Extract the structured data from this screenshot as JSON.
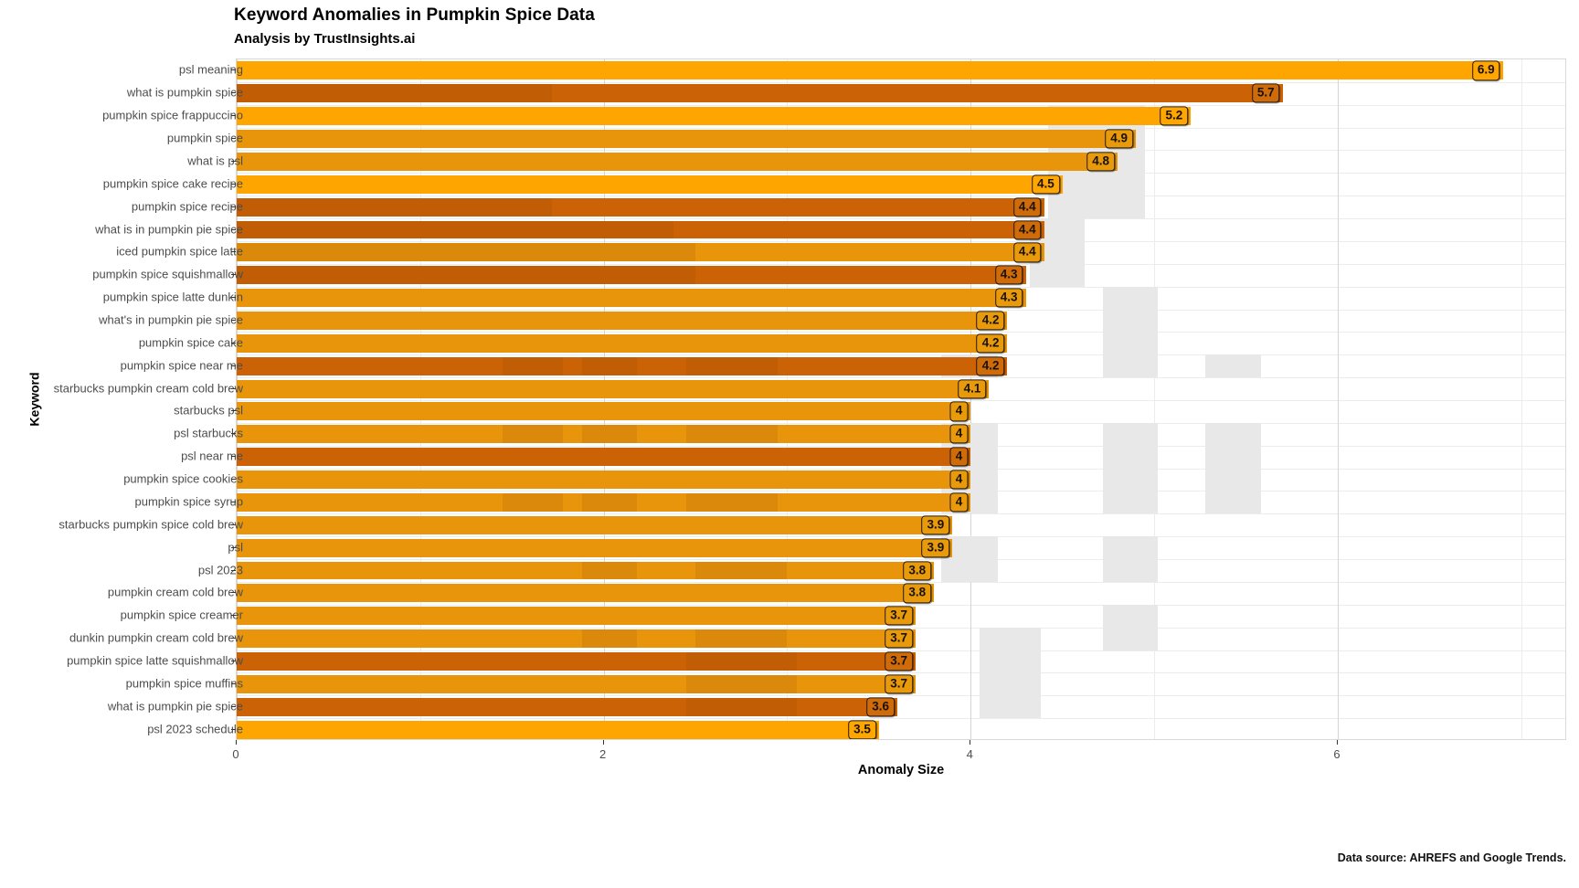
{
  "header": {
    "title": "Keyword Anomalies in Pumpkin Spice Data",
    "subtitle": "Analysis by TrustInsights.ai"
  },
  "footer": {
    "caption": "Data source: AHREFS and Google Trends."
  },
  "colors": {
    "bar_light": "#FFA500",
    "bar_medium": "#E8950C",
    "bar_dark": "#CC6206",
    "label_light_fill": "#FFA600",
    "label_medium_fill": "#E89A0B",
    "label_dark_fill": "#CF6B08",
    "label_border": "#231a10",
    "gray_block": "#e8e8e8",
    "panel_bg": "#FFFFFF",
    "gridline": "#ececec"
  },
  "chart_data": {
    "type": "bar",
    "orientation": "horizontal",
    "title": "Keyword Anomalies in Pumpkin Spice Data",
    "subtitle": "Analysis by TrustInsights.ai",
    "xlabel": "Anomaly Size",
    "ylabel": "Keyword",
    "xlim": [
      0,
      7.25
    ],
    "xticks": [
      0,
      2,
      4,
      6
    ],
    "xtick_labels": [
      "0",
      "2",
      "4",
      "6"
    ],
    "grid": true,
    "legend": false,
    "categories": [
      "psl meaning",
      "what is pumpkin spice",
      "pumpkin spice frappuccino",
      "pumpkin spice",
      "what is psl",
      "pumpkin spice cake recipe",
      "pumpkin spice recipe",
      "what is in pumpkin pie spice",
      "iced pumpkin spice latte",
      "pumpkin spice squishmallow",
      "pumpkin spice latte dunkin",
      "what's in pumpkin pie spice",
      "pumpkin spice cake",
      "pumpkin spice near me",
      "starbucks pumpkin cream cold brew",
      "starbucks psl",
      "psl starbucks",
      "psl near me",
      "pumpkin spice cookies",
      "pumpkin spice syrup",
      "starbucks pumpkin spice cold brew",
      "psl",
      "psl 2023",
      "pumpkin cream cold brew",
      "pumpkin spice creamer",
      "dunkin pumpkin cream cold brew",
      "pumpkin spice latte squishmallow",
      "pumpkin spice muffins",
      "what is pumpkin pie spice",
      "psl 2023 schedule"
    ],
    "values": [
      6.9,
      5.7,
      5.2,
      4.9,
      4.8,
      4.5,
      4.4,
      4.4,
      4.4,
      4.3,
      4.3,
      4.2,
      4.2,
      4.2,
      4.1,
      4,
      4,
      4,
      4,
      4,
      3.9,
      3.9,
      3.8,
      3.8,
      3.7,
      3.7,
      3.7,
      3.7,
      3.6,
      3.5
    ],
    "value_labels": [
      "6.9",
      "5.7",
      "5.2",
      "4.9",
      "4.8",
      "4.5",
      "4.4",
      "4.4",
      "4.4",
      "4.3",
      "4.3",
      "4.2",
      "4.2",
      "4.2",
      "4.1",
      "4",
      "4",
      "4",
      "4",
      "4",
      "3.9",
      "3.9",
      "3.8",
      "3.8",
      "3.7",
      "3.7",
      "3.7",
      "3.7",
      "3.6",
      "3.5"
    ],
    "bar_shades": [
      "light",
      "dark",
      "light",
      "medium",
      "medium",
      "light",
      "dark",
      "dark",
      "medium",
      "dark",
      "medium",
      "medium",
      "medium",
      "dark",
      "medium",
      "medium",
      "medium",
      "dark",
      "medium",
      "medium",
      "medium",
      "medium",
      "medium",
      "medium",
      "medium",
      "medium",
      "dark",
      "medium",
      "dark",
      "light"
    ]
  },
  "overlay_blocks": [
    {
      "x0": 4.42,
      "x1": 4.95,
      "row0": 2,
      "row1": 7
    },
    {
      "x0": 4.32,
      "x1": 4.62,
      "row0": 7,
      "row1": 10
    },
    {
      "x0": 4.72,
      "x1": 5.02,
      "row0": 10,
      "row1": 13
    },
    {
      "x0": 3.84,
      "x1": 4.15,
      "row0": 13,
      "row1": 14
    },
    {
      "x0": 4.72,
      "x1": 5.02,
      "row0": 13,
      "row1": 14
    },
    {
      "x0": 5.28,
      "x1": 5.58,
      "row0": 13,
      "row1": 14
    },
    {
      "x0": 3.84,
      "x1": 4.15,
      "row0": 16,
      "row1": 20
    },
    {
      "x0": 4.72,
      "x1": 5.02,
      "row0": 16,
      "row1": 20
    },
    {
      "x0": 5.28,
      "x1": 5.58,
      "row0": 16,
      "row1": 20
    },
    {
      "x0": 3.84,
      "x1": 4.15,
      "row0": 21,
      "row1": 23
    },
    {
      "x0": 4.72,
      "x1": 5.02,
      "row0": 21,
      "row1": 23
    },
    {
      "x0": 4.72,
      "x1": 5.02,
      "row0": 24,
      "row1": 26
    },
    {
      "x0": 4.05,
      "x1": 4.38,
      "row0": 25,
      "row1": 29
    }
  ],
  "band_overlays": [
    {
      "x0": 0.0,
      "x1": 1.72,
      "row": 1
    },
    {
      "x0": 0.0,
      "x1": 1.72,
      "row": 6
    },
    {
      "x0": 0.0,
      "x1": 2.38,
      "row": 7
    },
    {
      "x0": 0.0,
      "x1": 2.5,
      "row": 8
    },
    {
      "x0": 0.0,
      "x1": 2.5,
      "row": 9
    },
    {
      "x0": 1.45,
      "x1": 1.78,
      "row": 13
    },
    {
      "x0": 1.88,
      "x1": 2.18,
      "row": 13
    },
    {
      "x0": 2.45,
      "x1": 2.95,
      "row": 13
    },
    {
      "x0": 1.45,
      "x1": 1.78,
      "row": 16
    },
    {
      "x0": 1.88,
      "x1": 2.18,
      "row": 16
    },
    {
      "x0": 2.45,
      "x1": 2.95,
      "row": 16
    },
    {
      "x0": 1.45,
      "x1": 1.78,
      "row": 19
    },
    {
      "x0": 1.88,
      "x1": 2.18,
      "row": 19
    },
    {
      "x0": 2.45,
      "x1": 2.95,
      "row": 19
    },
    {
      "x0": 1.88,
      "x1": 2.18,
      "row": 22
    },
    {
      "x0": 2.5,
      "x1": 3.0,
      "row": 22
    },
    {
      "x0": 1.88,
      "x1": 2.18,
      "row": 25
    },
    {
      "x0": 2.5,
      "x1": 3.0,
      "row": 25
    },
    {
      "x0": 2.45,
      "x1": 3.05,
      "row": 26
    },
    {
      "x0": 2.45,
      "x1": 3.05,
      "row": 27
    },
    {
      "x0": 2.45,
      "x1": 3.05,
      "row": 28
    }
  ]
}
